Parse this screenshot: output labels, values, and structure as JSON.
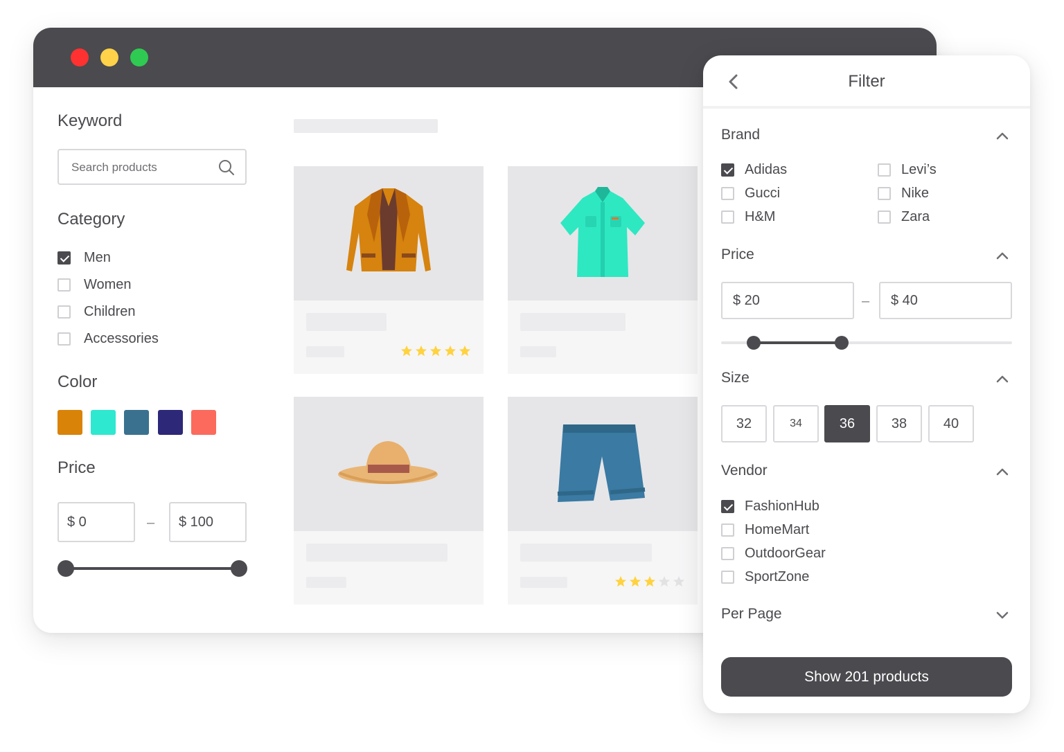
{
  "window": {
    "traffic_lights": {
      "close": "#ff3131",
      "minimize": "#ffd249",
      "maximize": "#2fca52"
    }
  },
  "sidebar": {
    "keyword": {
      "title": "Keyword",
      "placeholder": "Search products",
      "icon": "search-icon"
    },
    "category": {
      "title": "Category",
      "items": [
        {
          "label": "Men",
          "checked": true
        },
        {
          "label": "Women",
          "checked": false
        },
        {
          "label": "Children",
          "checked": false
        },
        {
          "label": "Accessories",
          "checked": false
        }
      ]
    },
    "color": {
      "title": "Color",
      "swatches": [
        "#d98309",
        "#2ee8cf",
        "#3a718f",
        "#2d2878",
        "#fb6a5c"
      ]
    },
    "price": {
      "title": "Price",
      "min": "$ 0",
      "max": "$ 100",
      "range_low": 0,
      "range_high": 100
    }
  },
  "products": [
    {
      "image": "jacket",
      "rating": 5
    },
    {
      "image": "shirt",
      "rating": null
    },
    {
      "image": "hat",
      "rating": null
    },
    {
      "image": "shorts",
      "rating": 3
    }
  ],
  "filter": {
    "title": "Filter",
    "back_icon": "chevron-left-icon",
    "brand": {
      "title": "Brand",
      "items": [
        {
          "label": "Adidas",
          "checked": true
        },
        {
          "label": "Levi’s",
          "checked": false
        },
        {
          "label": "Gucci",
          "checked": false
        },
        {
          "label": "Nike",
          "checked": false
        },
        {
          "label": "H&M",
          "checked": false
        },
        {
          "label": "Zara",
          "checked": false
        }
      ]
    },
    "price": {
      "title": "Price",
      "min": "$ 20",
      "max": "$ 40",
      "dash": "–"
    },
    "size": {
      "title": "Size",
      "options": [
        "32",
        "34",
        "36",
        "38",
        "40"
      ],
      "selected": "36"
    },
    "vendor": {
      "title": "Vendor",
      "items": [
        {
          "label": "FashionHub",
          "checked": true
        },
        {
          "label": "HomeMart",
          "checked": false
        },
        {
          "label": "OutdoorGear",
          "checked": false
        },
        {
          "label": "SportZone",
          "checked": false
        }
      ]
    },
    "per_page": {
      "title": "Per Page"
    },
    "show_button": "Show 201 products"
  },
  "colors": {
    "primary": "#4a4a4f",
    "star": "#ffd23f",
    "star_empty": "#e2e2e4"
  }
}
